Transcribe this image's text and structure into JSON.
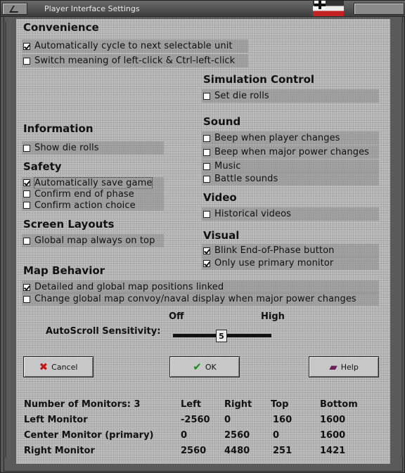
{
  "window": {
    "title": "Player Interface Settings"
  },
  "sections": {
    "convenience": {
      "title": "Convenience",
      "options": [
        {
          "label": "Automatically cycle to next selectable unit",
          "checked": true
        },
        {
          "label": "Switch meaning of left-click & Ctrl-left-click",
          "checked": false
        }
      ]
    },
    "simulation": {
      "title": "Simulation Control",
      "options": [
        {
          "label": "Set die rolls",
          "checked": false
        }
      ]
    },
    "information": {
      "title": "Information",
      "options": [
        {
          "label": "Show die rolls",
          "checked": false
        }
      ]
    },
    "sound": {
      "title": "Sound",
      "options": [
        {
          "label": "Beep when player changes",
          "checked": false
        },
        {
          "label": "Beep when major power changes",
          "checked": false
        },
        {
          "label": "Music",
          "checked": false
        },
        {
          "label": "Battle sounds",
          "checked": false
        }
      ]
    },
    "safety": {
      "title": "Safety",
      "options": [
        {
          "label": "Automatically save game",
          "checked": true
        },
        {
          "label": "Confirm end of phase",
          "checked": false
        },
        {
          "label": "Confirm action choice",
          "checked": false
        }
      ]
    },
    "video": {
      "title": "Video",
      "options": [
        {
          "label": "Historical videos",
          "checked": false
        }
      ]
    },
    "screen_layouts": {
      "title": "Screen Layouts",
      "options": [
        {
          "label": "Global map always on top",
          "checked": false
        }
      ]
    },
    "visual": {
      "title": "Visual",
      "options": [
        {
          "label": "Blink End-of-Phase button",
          "checked": true
        },
        {
          "label": "Only use primary monitor",
          "checked": true
        }
      ]
    },
    "map_behavior": {
      "title": "Map Behavior",
      "options": [
        {
          "label": "Detailed and global map positions linked",
          "checked": true
        },
        {
          "label": "Change global map convoy/naval display when major power changes",
          "checked": false
        }
      ]
    }
  },
  "autoscroll": {
    "label": "AutoScroll Sensitivity:",
    "min_label": "Off",
    "max_label": "High",
    "value": "5"
  },
  "buttons": {
    "cancel": "Cancel",
    "ok": "OK",
    "help": "Help"
  },
  "monitors": {
    "header": [
      "Number of Monitors: 3",
      "Left",
      "Right",
      "Top",
      "Bottom"
    ],
    "rows": [
      [
        "Left Monitor",
        "-2560",
        "0",
        "160",
        "1600"
      ],
      [
        "Center Monitor (primary)",
        "0",
        "2560",
        "0",
        "1600"
      ],
      [
        "Right Monitor",
        "2560",
        "4480",
        "251",
        "1421"
      ]
    ]
  }
}
